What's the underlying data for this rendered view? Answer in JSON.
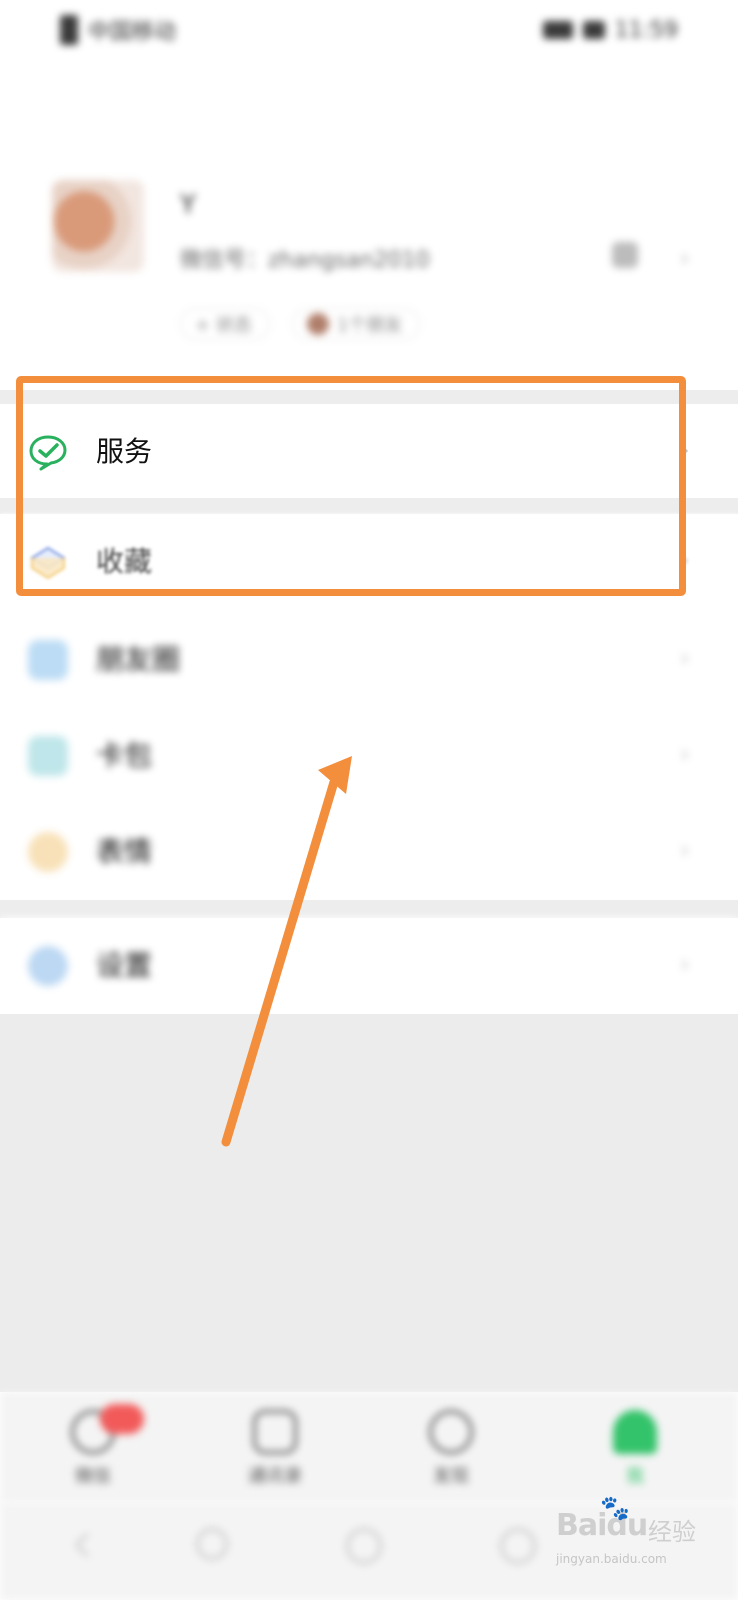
{
  "status_bar": {
    "left_text": "中国移动",
    "right_text": "11:59"
  },
  "profile": {
    "nickname": "Y",
    "wechat_id": "微信号：zhangsan2010",
    "status_pill_1": "+ 状态",
    "status_pill_2": "1个朋友"
  },
  "menu": {
    "services": "服务",
    "favorites": "收藏",
    "moments": "朋友圈",
    "cards": "卡包",
    "stickers": "表情",
    "settings": "设置",
    "chevron": "›"
  },
  "tab_bar": {
    "tabs": [
      {
        "label": "微信",
        "active": false
      },
      {
        "label": "通讯录",
        "active": false
      },
      {
        "label": "发现",
        "active": false
      },
      {
        "label": "我",
        "active": true
      }
    ]
  },
  "watermark": {
    "brand": "Bai",
    "brand_suffix": "du",
    "jingyan": "经验",
    "domain": "jingyan.baidu.com"
  },
  "colors": {
    "accent_green": "#33c36a",
    "annotation_orange": "#f28e3c",
    "badge_red": "#f25a5a"
  },
  "icons": {
    "services": "wechat-pay-check-icon",
    "favorites": "cube-icon",
    "moments": "image-icon",
    "cards": "card-icon",
    "stickers": "smile-icon",
    "settings": "gear-icon"
  }
}
